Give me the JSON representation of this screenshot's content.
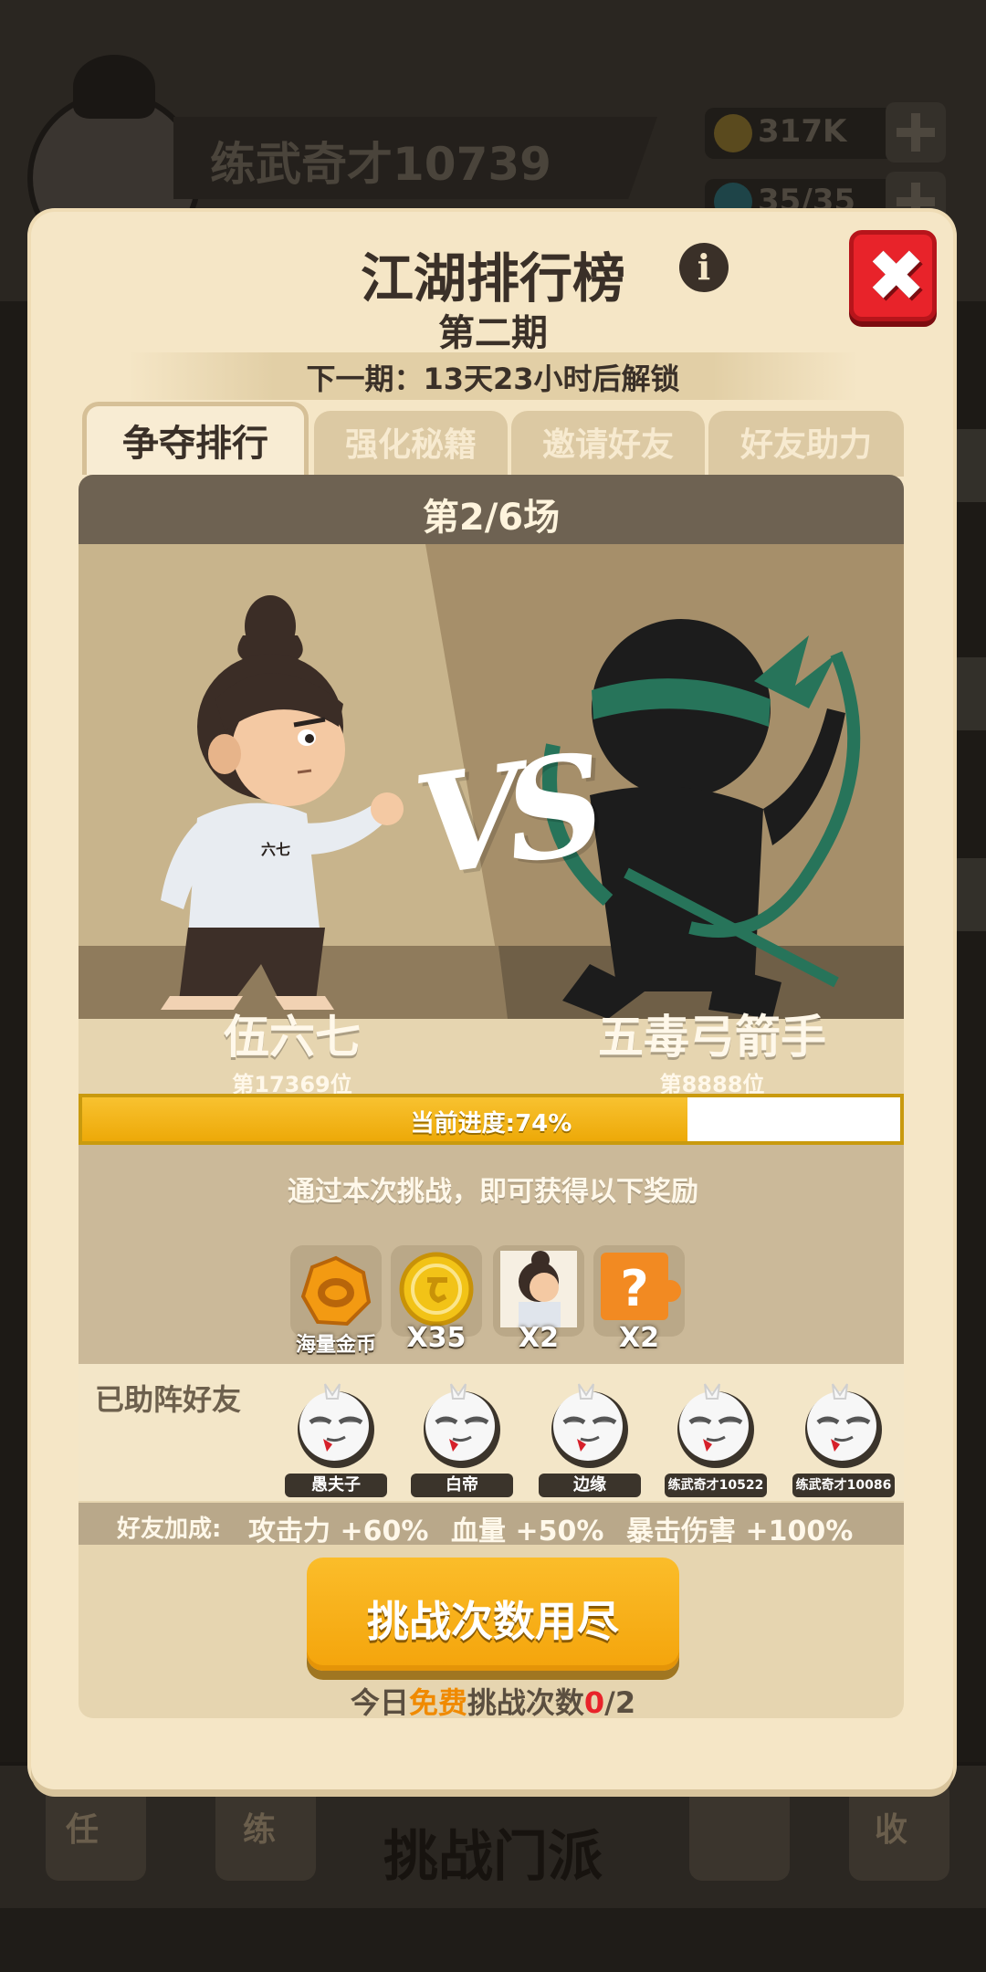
{
  "background": {
    "player_name": "练武奇才10739",
    "resource_gold": "317K",
    "resource_energy": "35/35",
    "bottom_nav_label": "挑战门派",
    "nav_icon_left1": "任",
    "nav_icon_left2": "练",
    "nav_icon_right2": "收"
  },
  "header": {
    "title": "江湖排行榜",
    "subtitle": "第二期",
    "next_period": "下一期：13天23小时后解锁",
    "info_glyph": "i",
    "close_glyph": "✖"
  },
  "tabs": [
    {
      "label": "争夺排行",
      "active": true
    },
    {
      "label": "强化秘籍",
      "active": false
    },
    {
      "label": "邀请好友",
      "active": false
    },
    {
      "label": "好友助力",
      "active": false
    }
  ],
  "battle": {
    "stage": "第2/6场",
    "vs_text": "VS",
    "player": {
      "name": "伍六七",
      "rank": "第17369位",
      "shirt_text": "六七"
    },
    "opponent": {
      "name": "五毒弓箭手",
      "rank": "第8888位"
    },
    "progress_label": "当前进度:74%",
    "progress_value": 0.74
  },
  "rewards": {
    "intro": "通过本次挑战，即可获得以下奖励",
    "items": [
      {
        "icon": "gold-ring-icon",
        "label": "海量金币"
      },
      {
        "icon": "coin-icon",
        "label": "X35"
      },
      {
        "icon": "character-portrait-icon",
        "label": "X2"
      },
      {
        "icon": "mystery-box-icon",
        "label": "X2",
        "glyph": "?"
      }
    ]
  },
  "friends": {
    "title": "已助阵好友",
    "list": [
      {
        "name": "愚夫子"
      },
      {
        "name": "白帝"
      },
      {
        "name": "边缘"
      },
      {
        "name": "练武奇才10522"
      },
      {
        "name": "练武奇才10086"
      }
    ]
  },
  "bonus": {
    "label": "好友加成:",
    "attack": "攻击力 +60%",
    "hp": "血量 +50%",
    "crit": "暴击伤害 +100%"
  },
  "challenge": {
    "button_label": "挑战次数用尽",
    "free_prefix": "今日",
    "free_highlight": "免费",
    "free_middle": "挑战次数",
    "free_count": "0",
    "free_total": "/2"
  },
  "colors": {
    "accent_orange": "#f4a40b",
    "close_red": "#e8232a",
    "panel_bg": "#f5e6c6"
  }
}
